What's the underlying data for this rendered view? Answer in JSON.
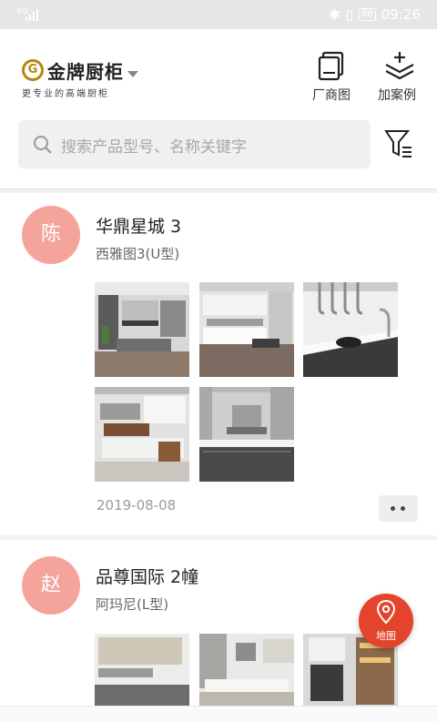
{
  "status_bar": {
    "network": "4G",
    "bluetooth_icon": "bluetooth-icon",
    "vibrate_icon": "vibrate-icon",
    "battery": "88",
    "time": "09:26"
  },
  "header": {
    "brand_name": "金牌厨柜",
    "brand_slogan": "更专业的高端厨柜",
    "brand_logo_icon": "g-logo-icon",
    "actions": [
      {
        "label": "厂商图",
        "icon": "catalog-icon"
      },
      {
        "label": "加案例",
        "icon": "add-layers-icon"
      }
    ],
    "search": {
      "placeholder": "搜索产品型号、名称关键字",
      "icon": "search-icon"
    },
    "filter_icon": "filter-icon"
  },
  "feed": [
    {
      "avatar": "陈",
      "title": "华鼎星城 3",
      "subtitle": "西雅图3(U型)",
      "image_count": 5,
      "date": "2019-08-08"
    },
    {
      "avatar": "赵",
      "title": "品尊国际 2幢",
      "subtitle": "阿玛尼(L型)",
      "image_count": 3
    }
  ],
  "map_button": {
    "label": "地图",
    "icon": "map-pin-icon"
  },
  "colors": {
    "accent": "#e3442b",
    "avatar": "#f4a49a",
    "brand_gold": "#b8860b"
  }
}
